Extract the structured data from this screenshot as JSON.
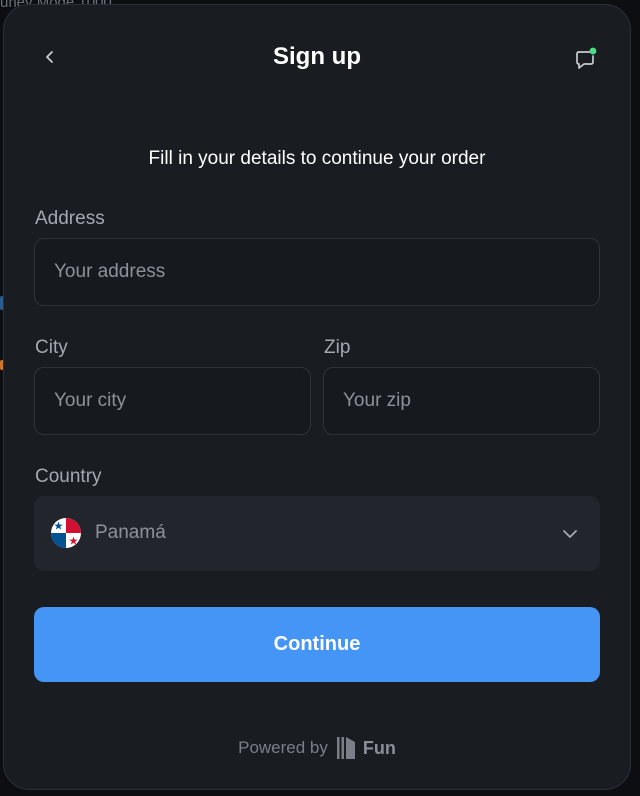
{
  "backdrop": {
    "top_text": "uney Mode 1000"
  },
  "header": {
    "title": "Sign up",
    "back_label": "Back",
    "chat_label": "Chat"
  },
  "form": {
    "subtitle": "Fill in your details to continue your order",
    "address": {
      "label": "Address",
      "placeholder": "Your address",
      "value": ""
    },
    "city": {
      "label": "City",
      "placeholder": "Your city",
      "value": ""
    },
    "zip": {
      "label": "Zip",
      "placeholder": "Your zip",
      "value": ""
    },
    "country": {
      "label": "Country",
      "selected": "Panamá",
      "flag_icon": "panama-flag-icon"
    }
  },
  "actions": {
    "continue_label": "Continue"
  },
  "footer": {
    "powered_by": "Powered by",
    "brand": "Fun"
  },
  "colors": {
    "accent": "#4595f7",
    "modal_bg": "#191c21",
    "notification_dot": "#4ade80"
  }
}
